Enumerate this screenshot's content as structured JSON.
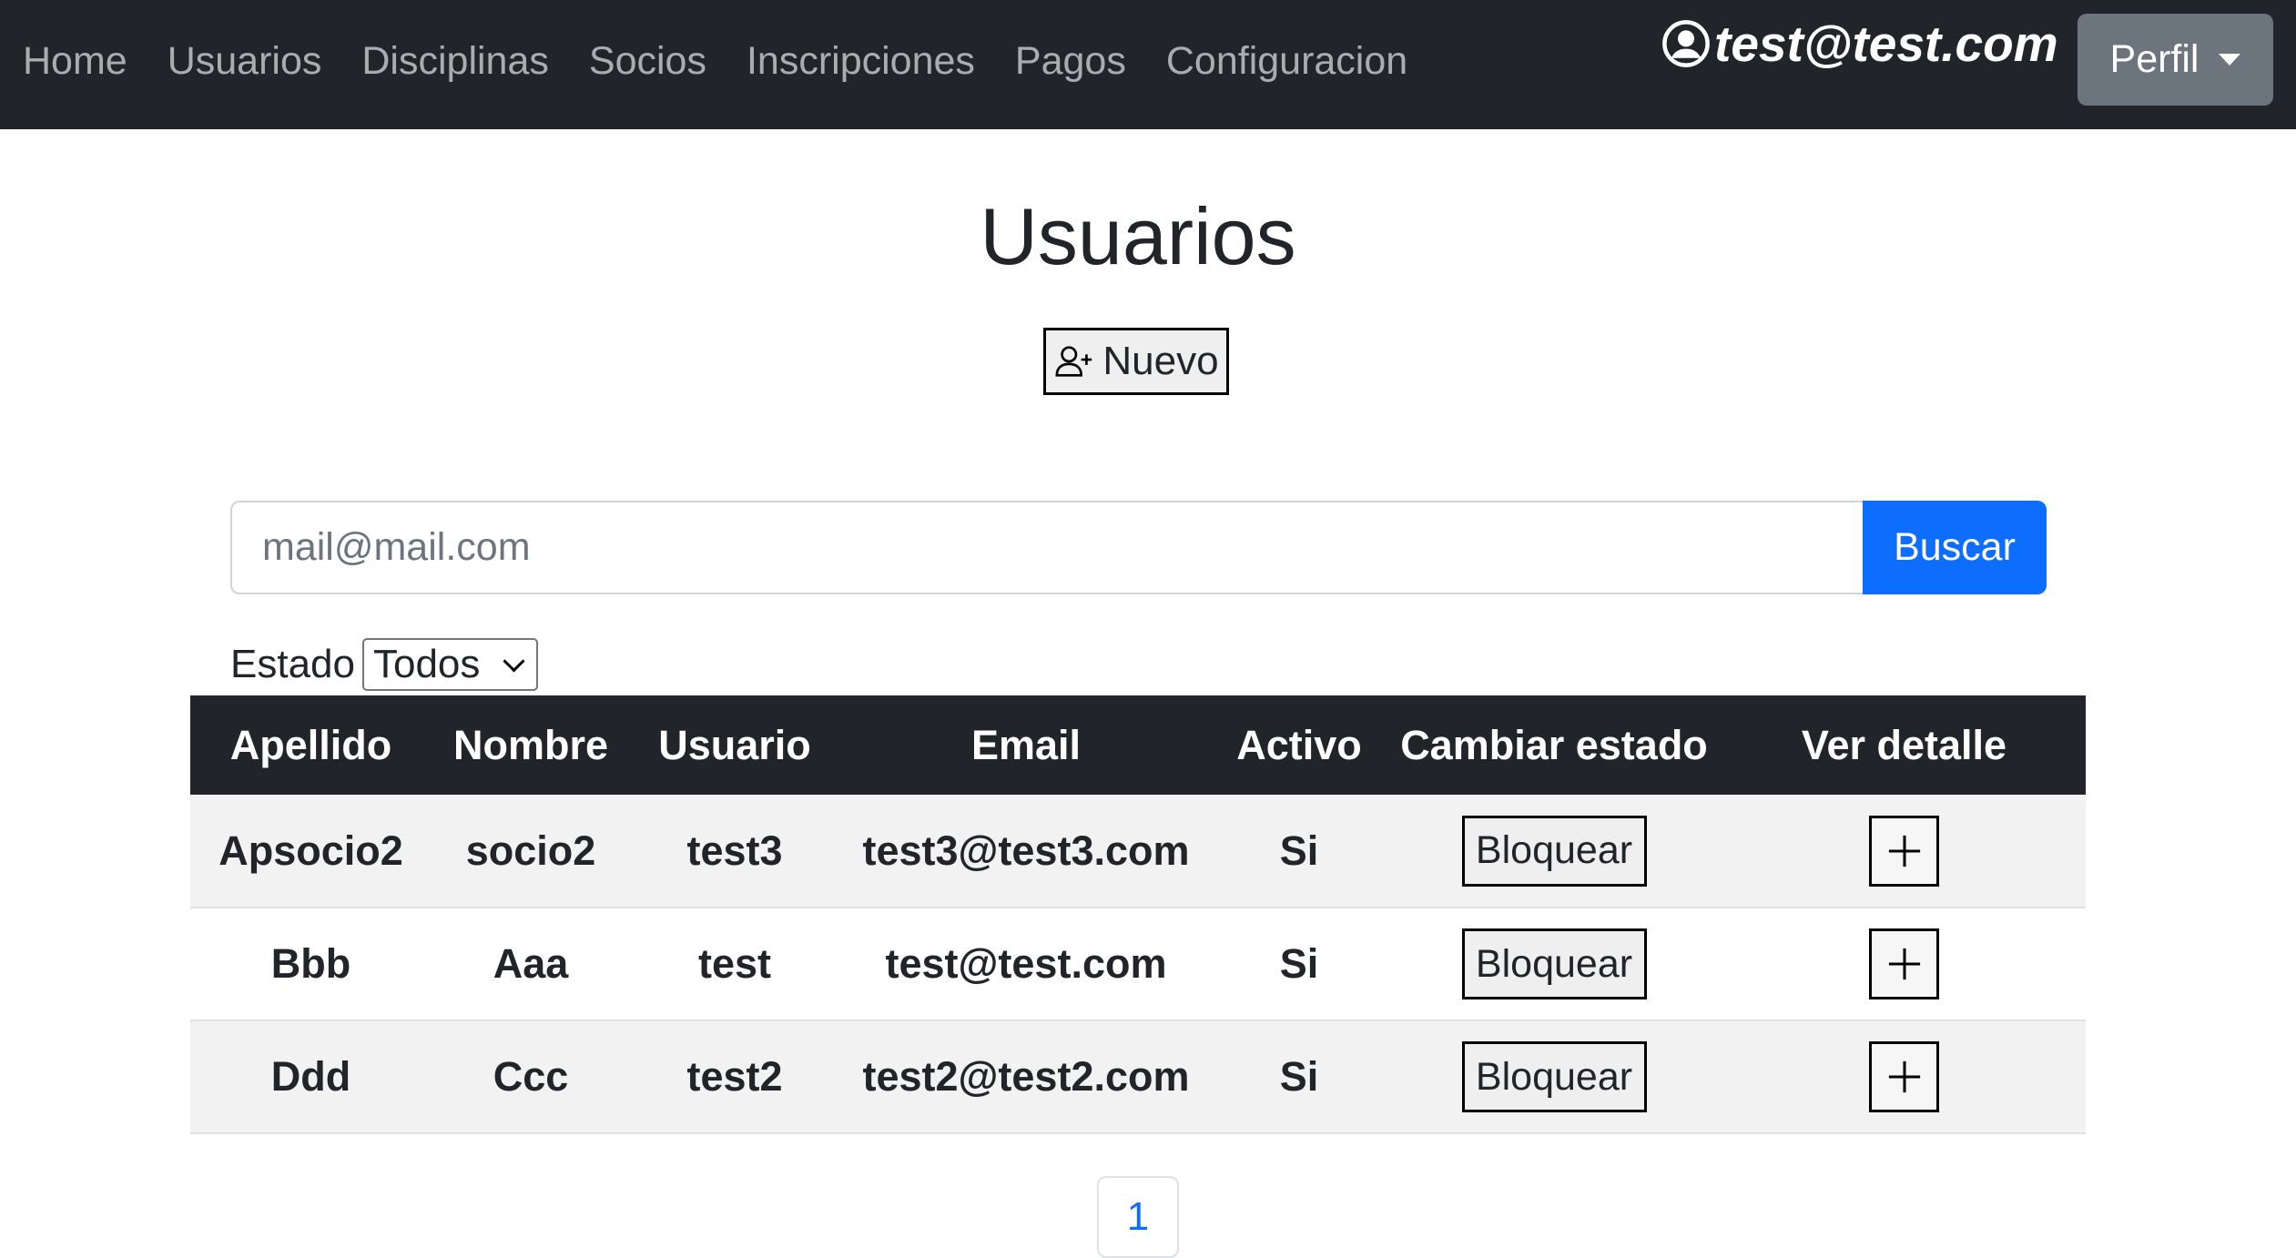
{
  "navbar": {
    "links": [
      "Home",
      "Usuarios",
      "Disciplinas",
      "Socios",
      "Inscripciones",
      "Pagos",
      "Configuracion"
    ],
    "user_email": "test@test.com",
    "profile_label": "Perfil"
  },
  "page": {
    "title": "Usuarios",
    "new_button_label": "Nuevo"
  },
  "search": {
    "placeholder": "mail@mail.com",
    "value": "",
    "button_label": "Buscar"
  },
  "filter": {
    "label": "Estado",
    "selected": "Todos"
  },
  "table": {
    "headers": [
      "Apellido",
      "Nombre",
      "Usuario",
      "Email",
      "Activo",
      "Cambiar estado",
      "Ver detalle"
    ],
    "rows": [
      {
        "apellido": "Apsocio2",
        "nombre": "socio2",
        "usuario": "test3",
        "email": "test3@test3.com",
        "activo": "Si",
        "action_label": "Bloquear"
      },
      {
        "apellido": "Bbb",
        "nombre": "Aaa",
        "usuario": "test",
        "email": "test@test.com",
        "activo": "Si",
        "action_label": "Bloquear"
      },
      {
        "apellido": "Ddd",
        "nombre": "Ccc",
        "usuario": "test2",
        "email": "test2@test2.com",
        "activo": "Si",
        "action_label": "Bloquear"
      }
    ]
  },
  "pagination": {
    "current_page": "1"
  },
  "colors": {
    "navbar_bg": "#212529",
    "primary": "#0d6efd",
    "secondary": "#6c757d"
  },
  "icons": {
    "user": "person-circle-icon",
    "new_user": "person-plus-icon",
    "detail": "plus-icon",
    "dropdown": "caret-down-icon"
  }
}
